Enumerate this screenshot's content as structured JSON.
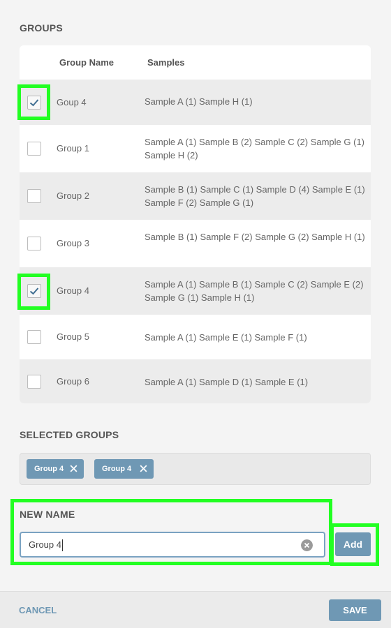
{
  "groups_section": {
    "title": "GROUPS",
    "header_name": "Group Name",
    "header_samples": "Samples",
    "rows": [
      {
        "name": "Goup 4",
        "samples": "Sample A (1) Sample H (1)",
        "checked": true
      },
      {
        "name": "Group 1",
        "samples": "Sample A (1) Sample B (2) Sample C (2) Sample G (1) Sample H (2)",
        "checked": false
      },
      {
        "name": "Group 2",
        "samples": "Sample B (1) Sample C (1) Sample D (4) Sample E (1) Sample F (2) Sample G (1)",
        "checked": false
      },
      {
        "name": "Group 3",
        "samples": "Sample B (1) Sample F (2) Sample G (2) Sample H (1)",
        "checked": false
      },
      {
        "name": "Group 4",
        "samples": "Sample A (1) Sample B (1) Sample C (2) Sample E (2) Sample G (1) Sample H (1)",
        "checked": true
      },
      {
        "name": "Group 5",
        "samples": "Sample A (1) Sample E (1) Sample F (1)",
        "checked": false
      },
      {
        "name": "Group 6",
        "samples": "Sample A (1) Sample D (1) Sample E (1)",
        "checked": false
      }
    ]
  },
  "selected_section": {
    "title": "SELECTED GROUPS",
    "chips": [
      {
        "label": "Group 4"
      },
      {
        "label": "Group 4"
      }
    ]
  },
  "new_name_section": {
    "title": "NEW NAME",
    "value": "Group 4",
    "add_label": "Add"
  },
  "footer": {
    "cancel_label": "CANCEL",
    "save_label": "SAVE"
  },
  "colors": {
    "accent": "#6f98b4",
    "highlight": "#22ff22"
  }
}
